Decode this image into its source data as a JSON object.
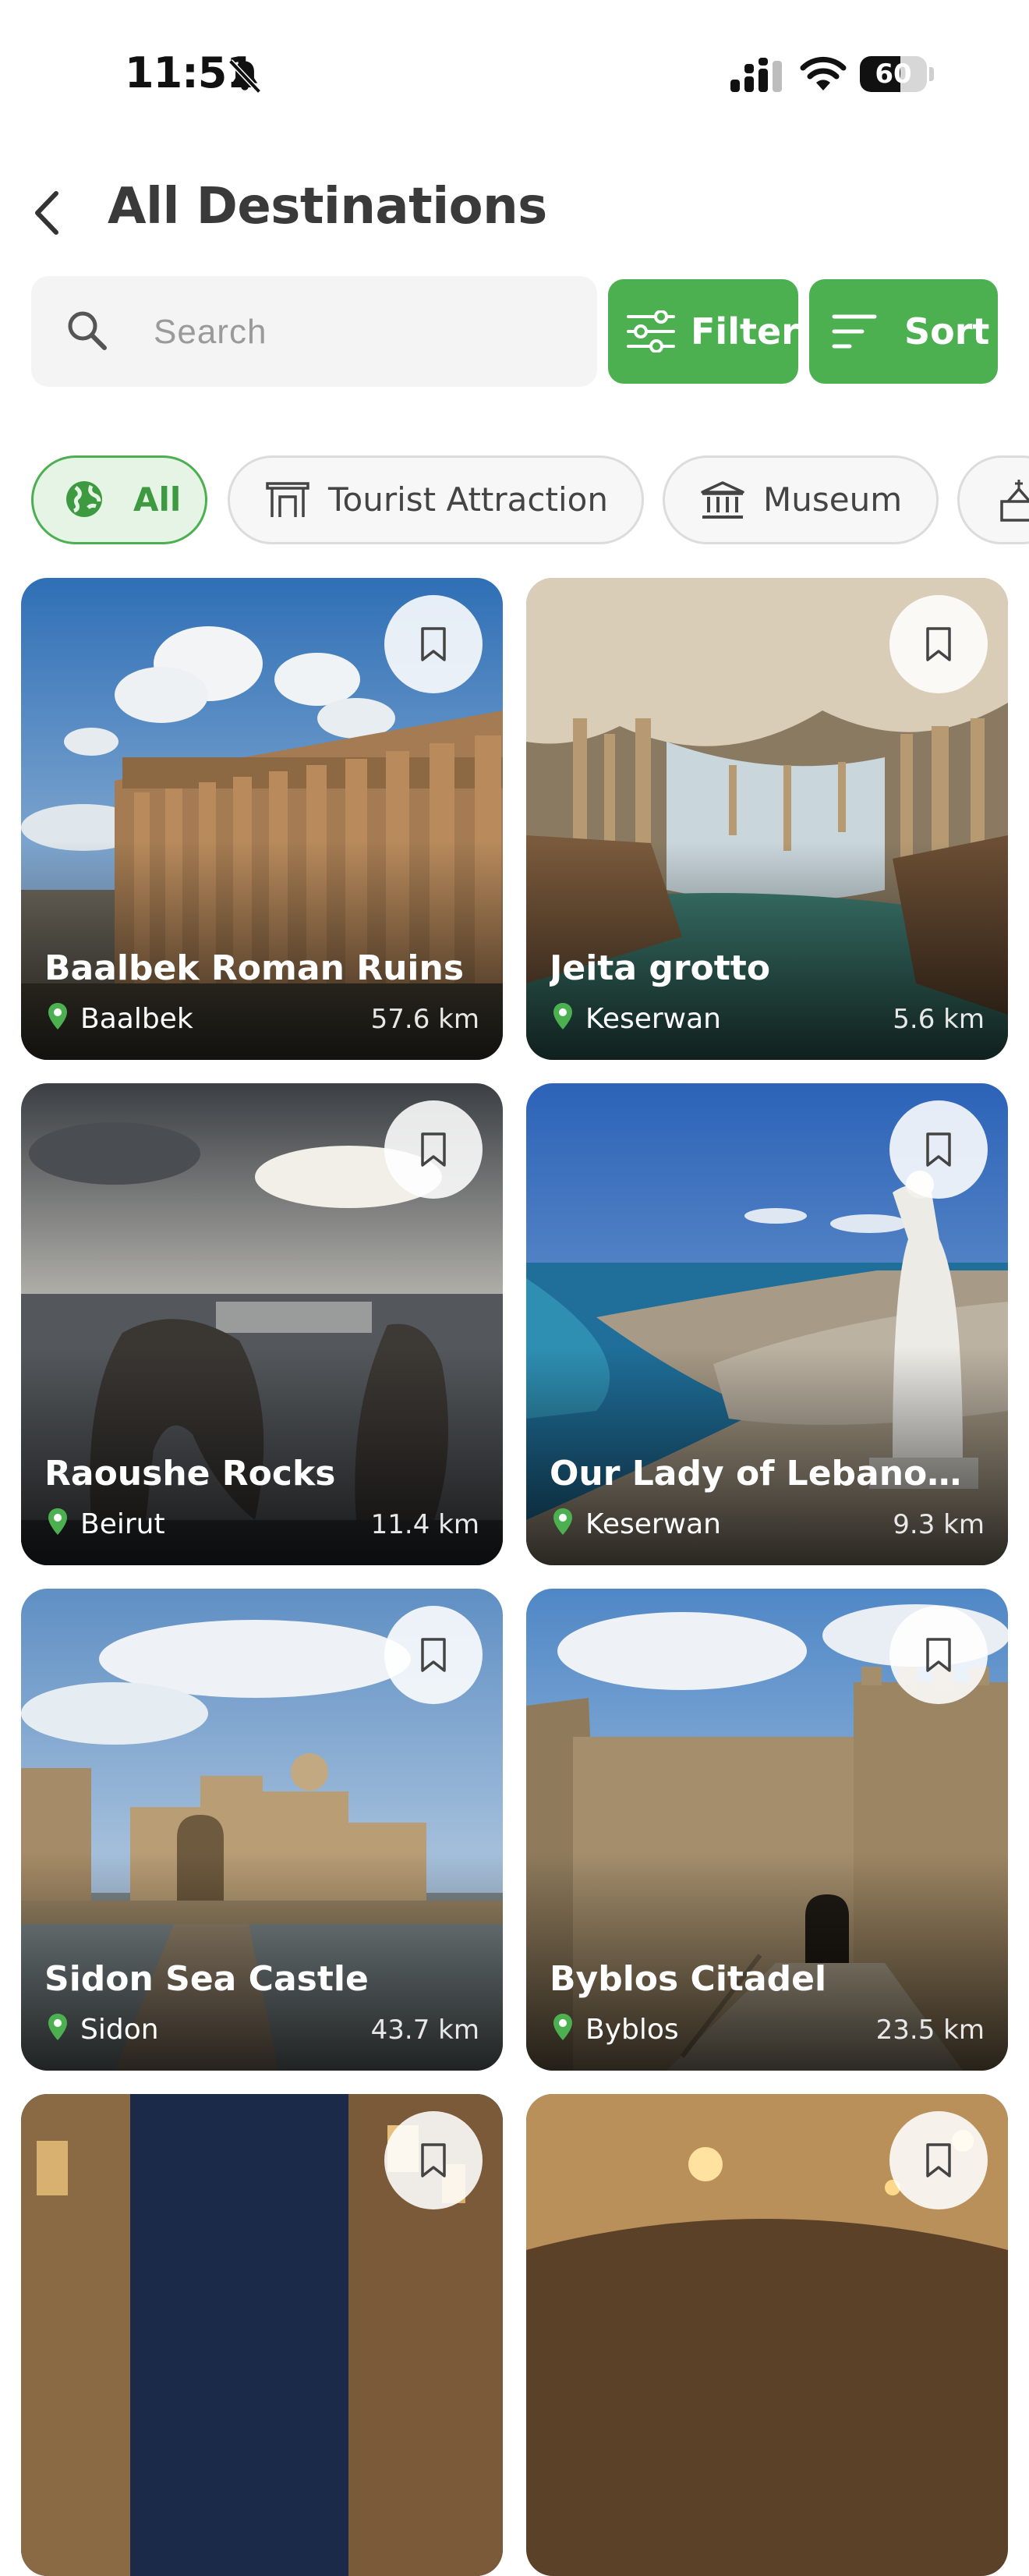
{
  "status_bar": {
    "time": "11:51",
    "battery": "60",
    "battery_level": 0.6
  },
  "header": {
    "title": "All Destinations"
  },
  "search": {
    "placeholder": "Search",
    "value": ""
  },
  "actions": {
    "filter_label": "Filter",
    "sort_label": "Sort",
    "accent_color": "#4caf50"
  },
  "categories": [
    {
      "label": "All",
      "icon": "globe-icon",
      "selected": true
    },
    {
      "label": "Tourist Attraction",
      "icon": "gate-icon",
      "selected": false
    },
    {
      "label": "Museum",
      "icon": "museum-icon",
      "selected": false
    },
    {
      "label": "",
      "icon": "church-icon",
      "selected": false
    }
  ],
  "destinations": [
    {
      "name": "Baalbek Roman Ruins",
      "location": "Baalbek",
      "distance": "57.6 km"
    },
    {
      "name": "Jeita grotto",
      "location": "Keserwan",
      "distance": "5.6 km"
    },
    {
      "name": "Raoushe Rocks",
      "location": "Beirut",
      "distance": "11.4 km"
    },
    {
      "name": "Our Lady of Lebanon - ...",
      "location": "Keserwan",
      "distance": "9.3 km"
    },
    {
      "name": "Sidon Sea Castle",
      "location": "Sidon",
      "distance": "43.7 km"
    },
    {
      "name": "Byblos Citadel",
      "location": "Byblos",
      "distance": "23.5 km"
    },
    {
      "name": "",
      "location": "",
      "distance": ""
    },
    {
      "name": "",
      "location": "",
      "distance": ""
    }
  ]
}
